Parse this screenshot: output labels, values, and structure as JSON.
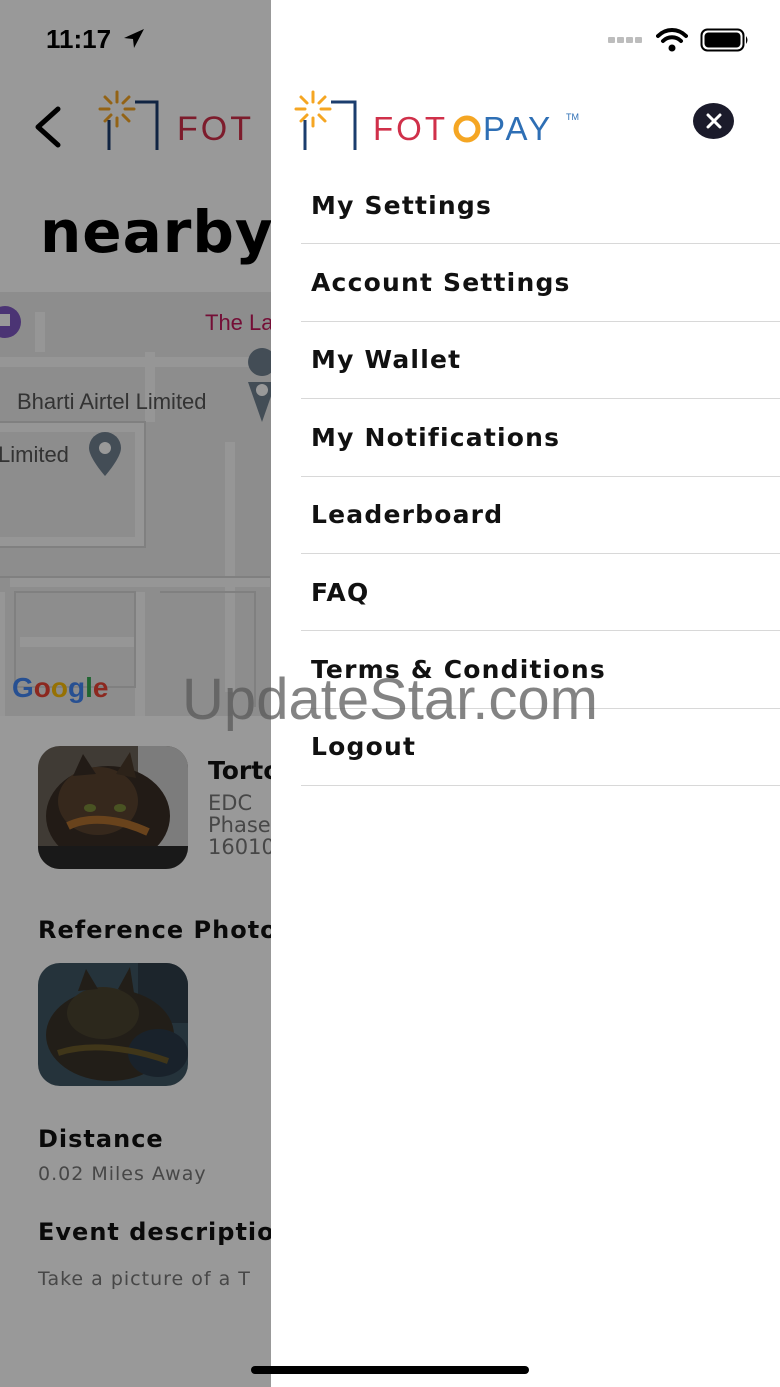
{
  "status_bar": {
    "time": "11:17"
  },
  "brand": {
    "name_part1": "FOT",
    "name_part2": "PAY",
    "trademark": "TM",
    "colors": {
      "red": "#d0304a",
      "orange": "#f5a623",
      "blue": "#2e6fb5",
      "navy": "#1b3d6e"
    }
  },
  "background": {
    "title": "nearby",
    "map": {
      "labels": [
        "The La",
        "Bharti Airtel Limited",
        "Limited"
      ],
      "google": [
        "G",
        "o",
        "o",
        "g",
        "l",
        "e"
      ]
    },
    "event": {
      "name": "Torto",
      "address_lines": [
        "EDC",
        "Phase",
        "16010"
      ]
    },
    "reference_photo_label": "Reference Photo",
    "distance_label": "Distance",
    "distance_value": "0.02 Miles Away",
    "event_description_label": "Event description",
    "event_description_text": "Take a picture of a T"
  },
  "drawer": {
    "menu": [
      {
        "label": "My Settings"
      },
      {
        "label": "Account Settings"
      },
      {
        "label": "My Wallet"
      },
      {
        "label": "My Notifications"
      },
      {
        "label": "Leaderboard"
      },
      {
        "label": "FAQ"
      },
      {
        "label": "Terms & Conditions"
      },
      {
        "label": "Logout"
      }
    ]
  },
  "watermark": "UpdateStar.com"
}
